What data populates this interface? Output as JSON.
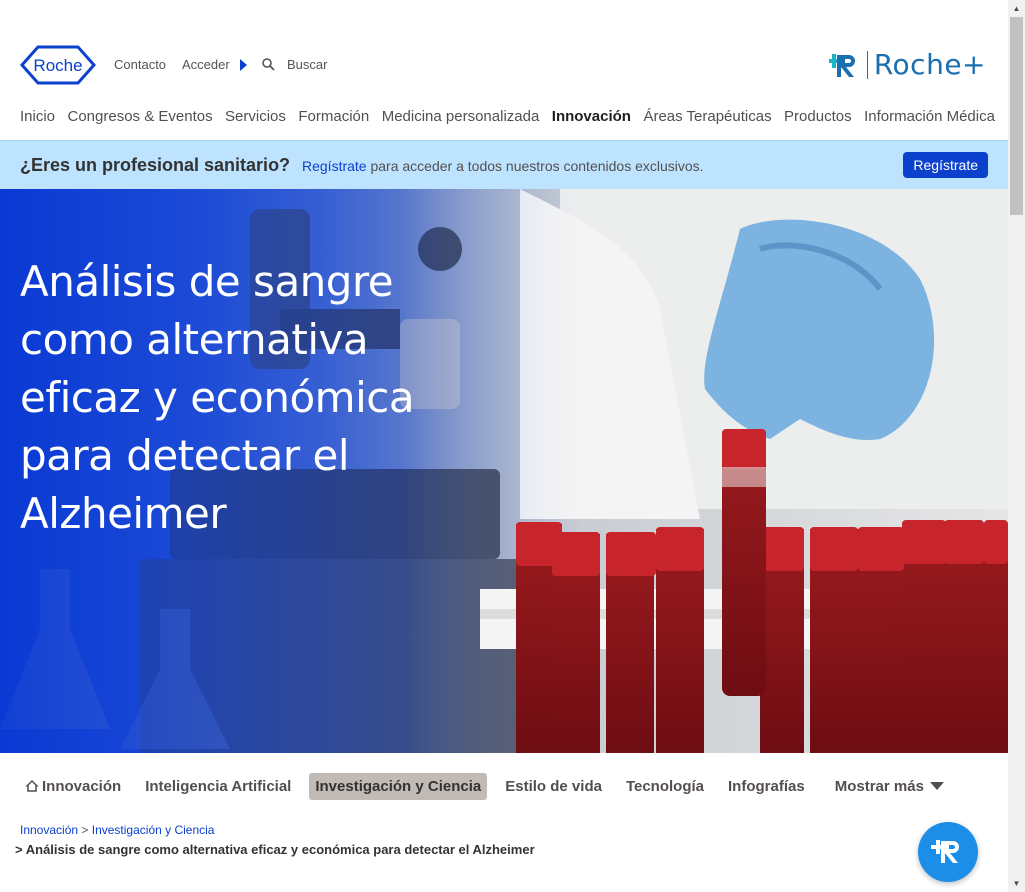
{
  "header": {
    "logo_text": "Roche",
    "contact": "Contacto",
    "login": "Acceder",
    "search_placeholder": "Buscar",
    "roche_plus": "Roche+"
  },
  "nav": {
    "items": [
      "Inicio",
      "Congresos & Eventos",
      "Servicios",
      "Formación",
      "Medicina personalizada",
      "Innovación",
      "Áreas Terapéuticas",
      "Productos",
      "Información Médica"
    ],
    "active": "Innovación"
  },
  "banner": {
    "question": "¿Eres un profesional sanitario?",
    "link": "Regístrate",
    "text": " para acceder a todos nuestros contenidos exclusivos.",
    "button": "Regístrate"
  },
  "hero": {
    "title": "Análisis de sangre como alternativa eficaz y económica para detectar el Alzheimer"
  },
  "subnav": {
    "items": [
      "Innovación",
      "Inteligencia Artificial",
      "Investigación y Ciencia",
      "Estilo de vida",
      "Tecnología",
      "Infografías"
    ],
    "active": "Investigación y Ciencia",
    "more": "Mostrar más"
  },
  "breadcrumb": {
    "level1": "Innovación",
    "separator": ">",
    "level2": "Investigación y Ciencia",
    "current_prefix": ">",
    "current": "Análisis de sangre como alternativa eficaz y económica para detectar el Alzheimer"
  },
  "colors": {
    "brand_blue": "#0b41cd",
    "banner_bg": "#bde3ff",
    "roche_plus": "#1a6fb0"
  }
}
